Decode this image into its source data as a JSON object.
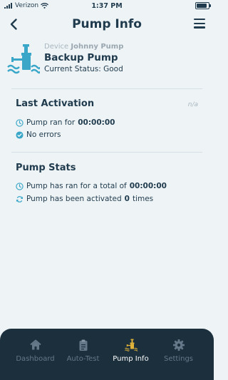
{
  "status_bar": {
    "carrier": "Verizon",
    "time": "1:37 PM",
    "battery_level": 0.85
  },
  "header": {
    "title": "Pump Info"
  },
  "device": {
    "device_label": "Device",
    "device_name": "Johnny Pump",
    "pump_name": "Backup Pump",
    "status_text": "Current Status: Good"
  },
  "last_activation": {
    "title": "Last Activation",
    "badge": "n/a",
    "ran_prefix": "Pump ran for ",
    "ran_value": "00:00:00",
    "errors_text": "No errors"
  },
  "pump_stats": {
    "title": "Pump Stats",
    "total_prefix": "Pump has ran for a total of ",
    "total_value": "00:00:00",
    "activated_prefix": "Pump has been activated ",
    "activated_count": "0",
    "activated_suffix": " times"
  },
  "tabs": [
    {
      "label": "Dashboard",
      "icon": "home-icon"
    },
    {
      "label": "Auto-Test",
      "icon": "clipboard-icon"
    },
    {
      "label": "Pump Info",
      "icon": "pump-icon",
      "active": true
    },
    {
      "label": "Settings",
      "icon": "gear-icon"
    }
  ],
  "colors": {
    "accent": "#3aa7c9",
    "dark": "#1f3b4d",
    "tabbar": "#1b2f3d",
    "pump_active": "#e0b23a"
  }
}
